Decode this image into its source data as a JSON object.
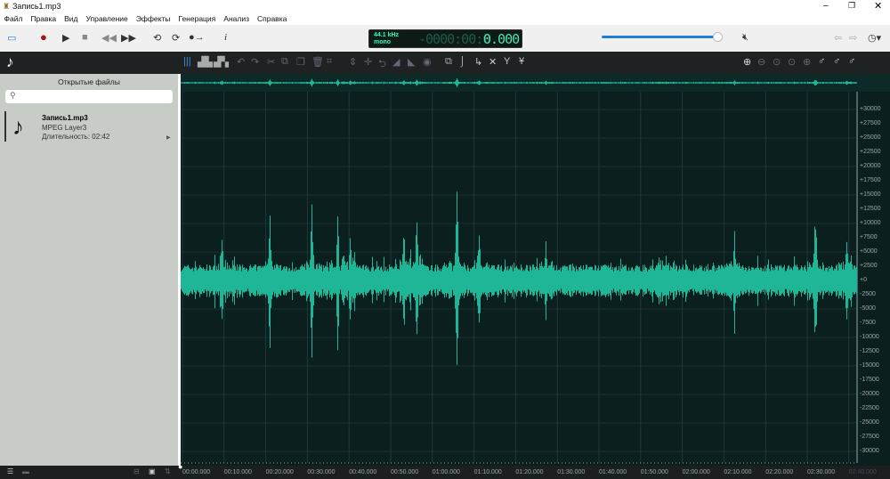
{
  "window": {
    "title": "Запись1.mp3"
  },
  "menu": [
    "Файл",
    "Правка",
    "Вид",
    "Управление",
    "Эффекты",
    "Генерация",
    "Анализ",
    "Справка"
  ],
  "transport": {
    "sample_rate": "44.1 kHz",
    "channels": "mono",
    "time_dim": "-0000:00:0",
    "time_value": "0.000",
    "volume_percent": 95
  },
  "sidebar": {
    "header": "Открытые файлы",
    "search_placeholder": "",
    "file": {
      "name": "Запись1.mp3",
      "format": "MPEG Layer3",
      "duration": "Длительность: 02:42"
    }
  },
  "y_labels": [
    "+30000",
    "+27500",
    "+25000",
    "+22500",
    "+20000",
    "+17500",
    "+15000",
    "+12500",
    "+10000",
    "+7500",
    "+5000",
    "+2500",
    "+0",
    "-2500",
    "-5000",
    "-7500",
    "-10000",
    "-12500",
    "-15000",
    "-17500",
    "-20000",
    "-22500",
    "-25000",
    "-27500",
    "-30000"
  ],
  "time_labels": [
    "00:00.000",
    "00:10.000",
    "00:20.000",
    "00:30.000",
    "00:40.000",
    "00:50.000",
    "01:00.000",
    "01:10.000",
    "01:20.000",
    "01:30.000",
    "01:40.000",
    "01:50.000",
    "02:00.000",
    "02:10.000",
    "02:20.000",
    "02:30.000",
    "02:40.000"
  ],
  "colors": {
    "wave": "#1fb597",
    "background": "#0b1f1e",
    "accent": "#1e7fd8",
    "record": "#a01818"
  }
}
